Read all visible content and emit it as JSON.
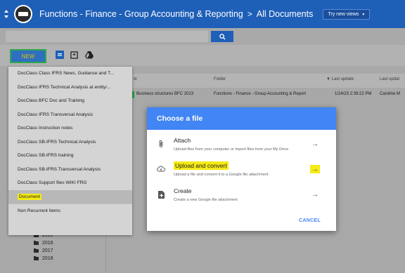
{
  "header": {
    "site_title": "Functions - Finance - Group Accounting & Reporting",
    "separator": ">",
    "current": "All Documents",
    "try_views_label": "Try new views",
    "try_views_caret": "▼"
  },
  "toolbar": {
    "new_label": "NEW"
  },
  "table": {
    "columns": [
      "le",
      "Folder",
      "▼ Last update",
      "Last updat"
    ],
    "row": {
      "name": "Business structures BFC 2023",
      "folder": "Functions - Finance - Group Accounting & Report",
      "last_update": "1/24/23 2:39:22 PM",
      "updated_by": "Caroline M"
    }
  },
  "menu": {
    "items": [
      "DocClass Class IFRS News, Guidance and T...",
      "DocClass IFRS Technical Analysis at entity/...",
      "DocClass BFC Doc and Training",
      "DocClass IFRS Transversal Analysis",
      "DocClass Instruction notes",
      "DocClass SB-IFRS Technical Analysis",
      "DocClass SB-IFRS training",
      "DocClass SB-IFRS Transversal Analysis",
      "DocClass Support files WIKI FRG",
      "Document",
      "Non Recurrent Items"
    ],
    "selected_index": 9
  },
  "tree": {
    "years": [
      "2015",
      "2016",
      "2017",
      "2018"
    ]
  },
  "modal": {
    "title": "Choose a file",
    "options": [
      {
        "title": "Attach",
        "subtitle": "Upload files from your computer or import files from your My Drive",
        "arrow": "→"
      },
      {
        "title": "Upload and convert",
        "subtitle": "Upload a file and convert it to a Google file attachment",
        "arrow": "→"
      },
      {
        "title": "Create",
        "subtitle": "Create a new Google file attachment",
        "arrow": "→"
      }
    ],
    "cancel_label": "CANCEL"
  },
  "colors": {
    "header_blue": "#1e5fb8",
    "modal_blue": "#4285f4",
    "highlight_yellow": "#f5eb15",
    "new_border_green": "#2ea84b"
  }
}
